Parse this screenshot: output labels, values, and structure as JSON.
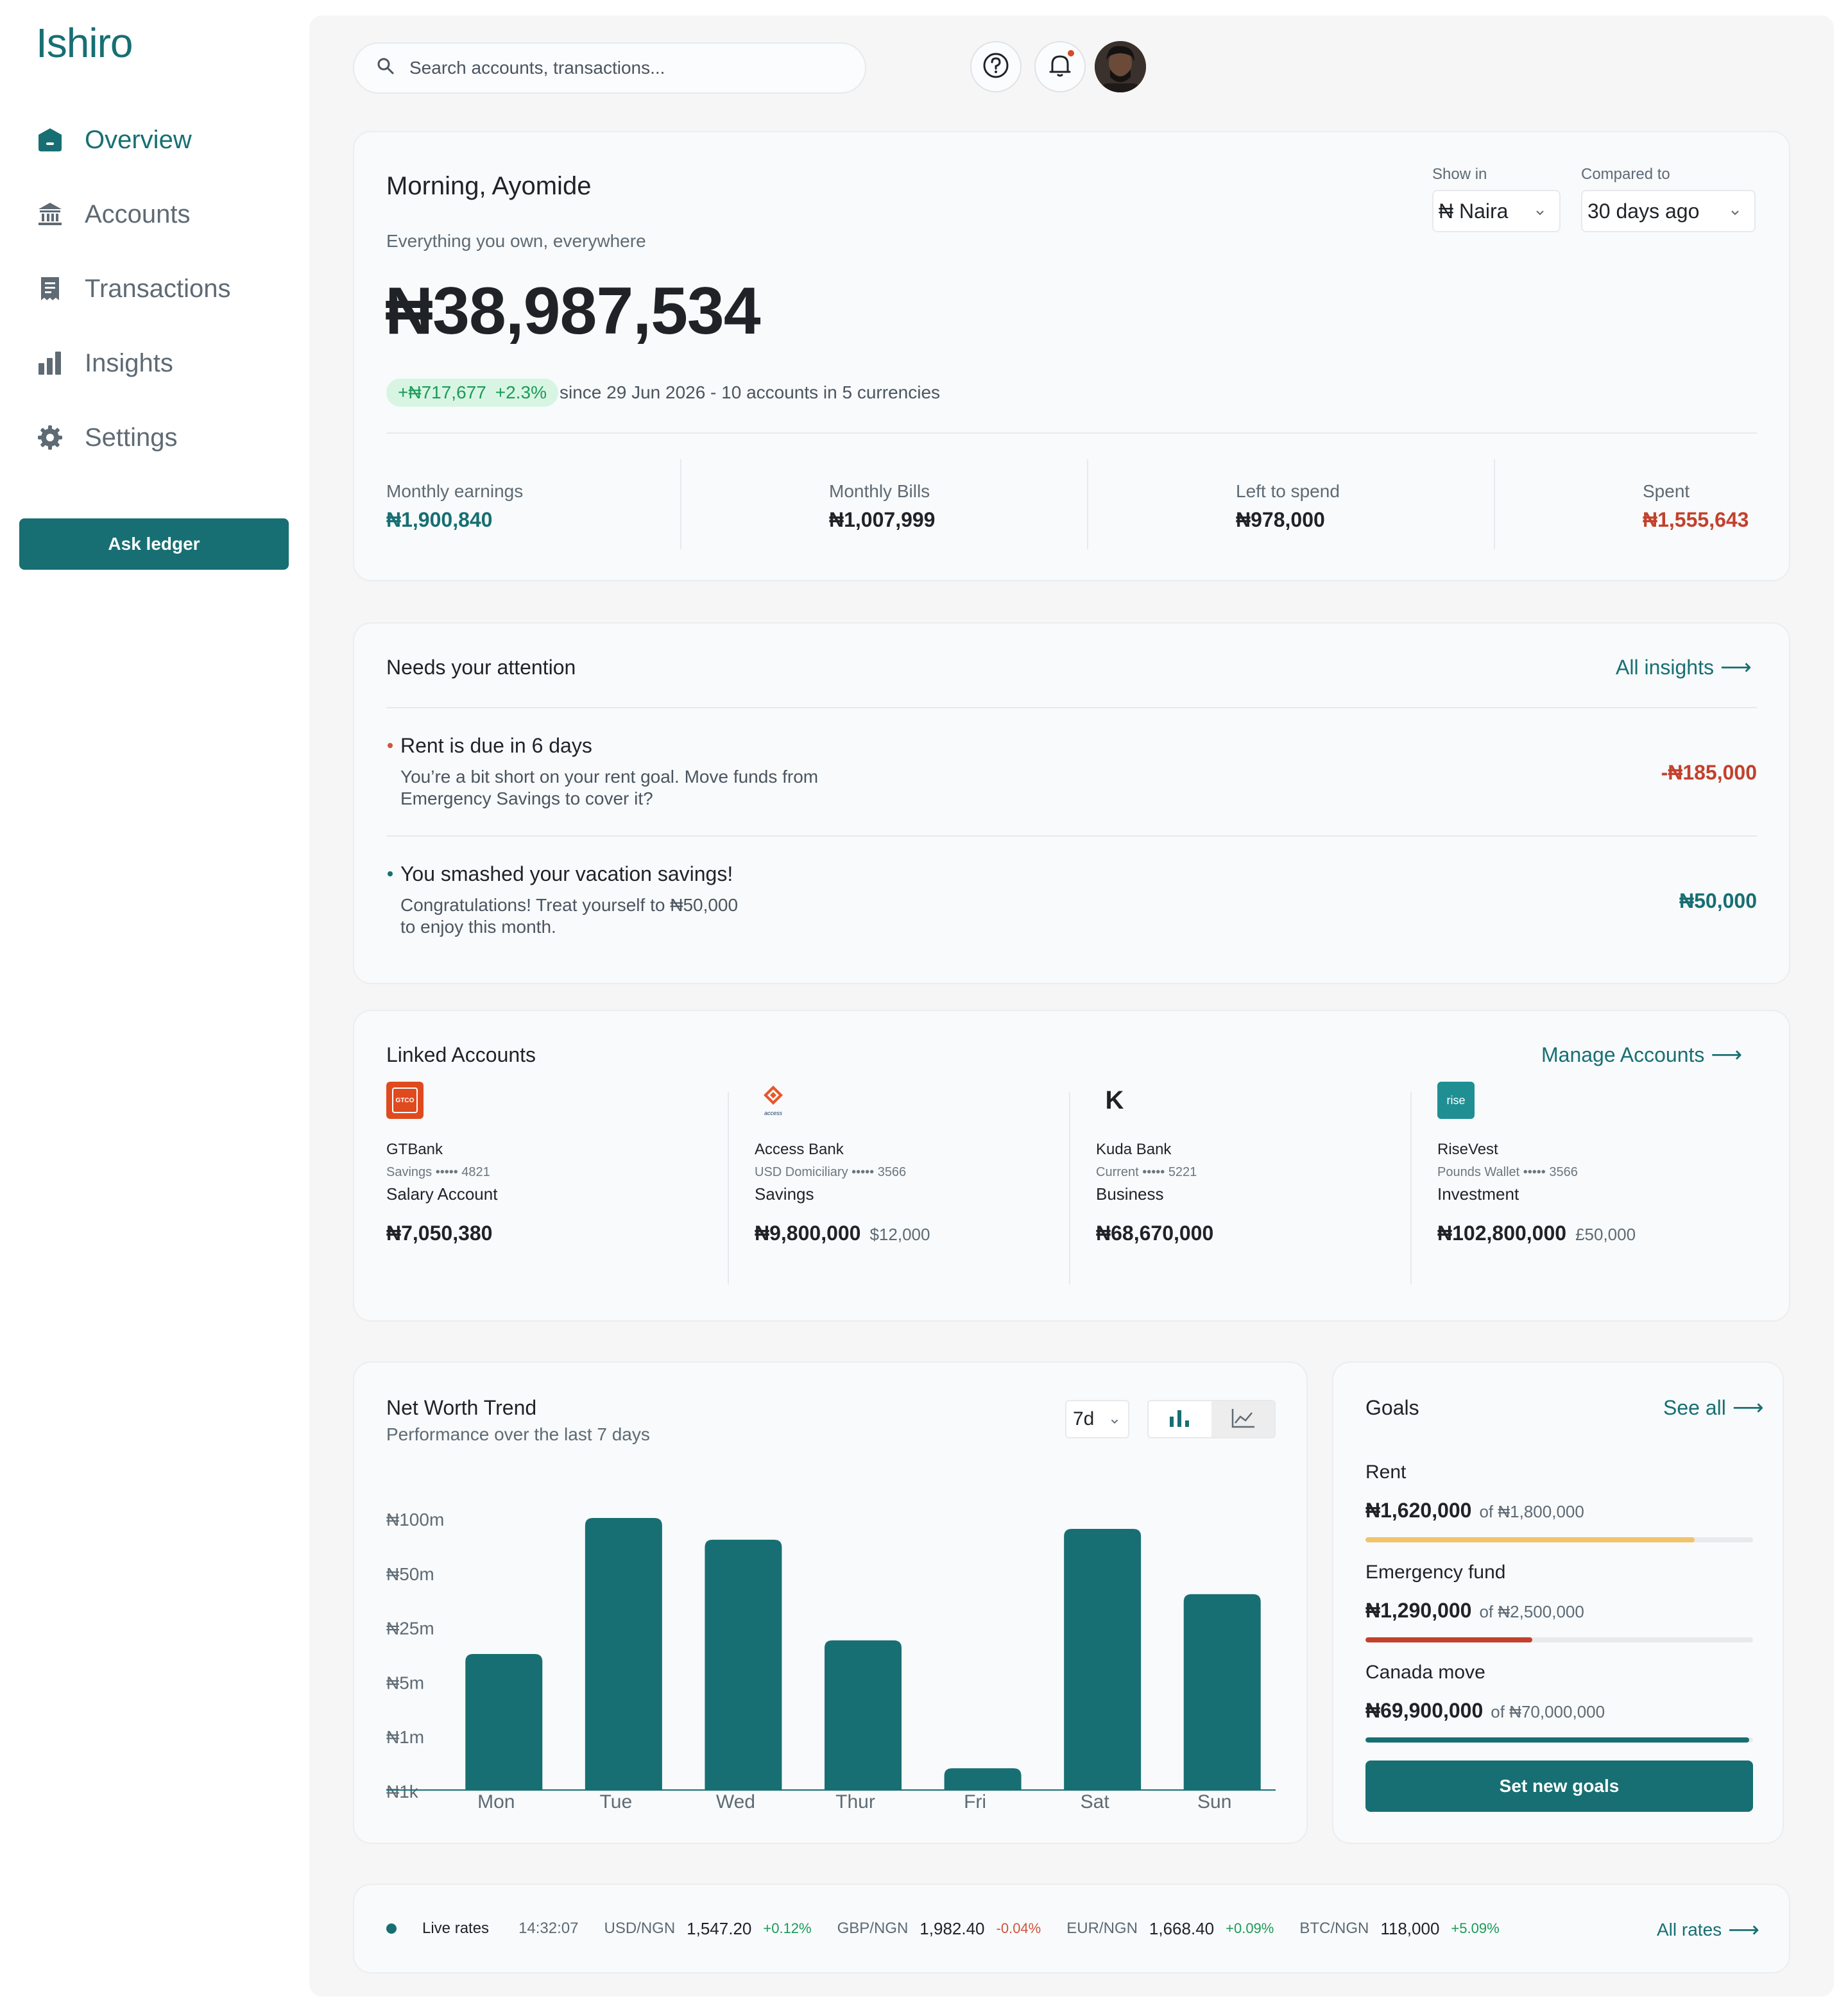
{
  "app": {
    "name": "Ishiro"
  },
  "sidebar": {
    "items": [
      {
        "label": "Overview",
        "icon": "home-icon",
        "active": true
      },
      {
        "label": "Accounts",
        "icon": "bank-icon",
        "active": false
      },
      {
        "label": "Transactions",
        "icon": "receipt-icon",
        "active": false
      },
      {
        "label": "Insights",
        "icon": "bar-chart-icon",
        "active": false
      },
      {
        "label": "Settings",
        "icon": "gear-icon",
        "active": false
      }
    ],
    "cta": "Ask ledger"
  },
  "header": {
    "search_placeholder": "Search  accounts, transactions...",
    "icons": [
      "help-icon",
      "bell-icon",
      "avatar"
    ]
  },
  "overview": {
    "greeting": "Morning, Ayomide",
    "subtitle": "Everything you own, everywhere",
    "total": "₦38,987,534",
    "delta_amount": "+₦717,677",
    "delta_pct": "+2.3%",
    "delta_text": "since 29 Jun 2026 - 10 accounts in 5 currencies",
    "show_in_label": "Show in",
    "show_in_value": "₦ Naira",
    "compared_label": "Compared to",
    "compared_value": "30 days ago",
    "stats": [
      {
        "label": "Monthly earnings",
        "value": "₦1,900,840",
        "color": "#176f73"
      },
      {
        "label": "Monthly Bills",
        "value": "₦1,007,999",
        "color": "#1f2328"
      },
      {
        "label": "Left to spend",
        "value": "₦978,000",
        "color": "#1f2328"
      },
      {
        "label": "Spent",
        "value": "₦1,555,643",
        "color": "#c2412d"
      }
    ]
  },
  "attention": {
    "title": "Needs your attention",
    "link": "All insights",
    "items": [
      {
        "title": "Rent is due in 6 days",
        "desc1": "You’re a bit short on your rent goal. Move funds from",
        "desc2": "Emergency Savings to cover it?",
        "amount": "-₦185,000",
        "color": "#c2412d"
      },
      {
        "title": "You smashed your vacation savings!",
        "desc1": "Congratulations! Treat yourself to ₦50,000",
        "desc2": "to enjoy this month.",
        "amount": "₦50,000",
        "color": "#176f73"
      }
    ]
  },
  "linked": {
    "title": "Linked Accounts",
    "link": "Manage Accounts",
    "accounts": [
      {
        "bank": "GTBank",
        "logo_text": "GTCO",
        "meta": "Savings ••••• 4821",
        "type": "Salary Account",
        "balance": "₦7,050,380",
        "secondary": ""
      },
      {
        "bank": "Access Bank",
        "logo_text": "access",
        "meta": "USD Domiciliary ••••• 3566",
        "type": "Savings",
        "balance": "₦9,800,000",
        "secondary": "$12,000"
      },
      {
        "bank": "Kuda Bank",
        "logo_text": "K",
        "meta": "Current ••••• 5221",
        "type": "Business",
        "balance": "₦68,670,000",
        "secondary": ""
      },
      {
        "bank": "RiseVest",
        "logo_text": "rise",
        "meta": "Pounds Wallet ••••• 3566",
        "type": "Investment",
        "balance": "₦102,800,000",
        "secondary": "£50,000"
      }
    ]
  },
  "trend": {
    "title": "Net Worth Trend",
    "subtitle": "Performance over the last 7 days",
    "range": "7d"
  },
  "chart_data": {
    "type": "bar",
    "categories": [
      "Mon",
      "Tue",
      "Wed",
      "Thur",
      "Fri",
      "Sat",
      "Sun"
    ],
    "y_ticks": [
      "₦100m",
      "₦50m",
      "₦25m",
      "₦5m",
      "₦1m",
      "₦1k"
    ],
    "values_tick_position": [
      2.5,
      5.0,
      4.6,
      2.75,
      0.4,
      4.8,
      3.6
    ],
    "ylim_ticks": [
      0,
      5
    ],
    "color": "#176f73"
  },
  "goals": {
    "title": "Goals",
    "link": "See all",
    "items": [
      {
        "name": "Rent",
        "current": "₦1,620,000",
        "target": "of  ₦1,800,000",
        "progress": 0.85,
        "color": "#f0c46a"
      },
      {
        "name": "Emergency fund",
        "current": "₦1,290,000",
        "target": "of  ₦2,500,000",
        "progress": 0.43,
        "color": "#c2412d"
      },
      {
        "name": "Canada move",
        "current": "₦69,900,000",
        "target": "of  ₦70,000,000",
        "progress": 0.99,
        "color": "#176f73"
      }
    ],
    "cta": "Set new goals"
  },
  "rates": {
    "label": "Live rates",
    "time": "14:32:07",
    "items": [
      {
        "pair": "USD/NGN",
        "value": "1,547.20",
        "change": "+0.12%",
        "color": "#1d9a59"
      },
      {
        "pair": "GBP/NGN",
        "value": "1,982.40",
        "change": "-0.04%",
        "color": "#d2553a"
      },
      {
        "pair": "EUR/NGN",
        "value": "1,668.40",
        "change": "+0.09%",
        "color": "#1d9a59"
      },
      {
        "pair": "BTC/NGN",
        "value": "118,000",
        "change": "+5.09%",
        "color": "#1d9a59"
      }
    ],
    "link": "All rates"
  }
}
